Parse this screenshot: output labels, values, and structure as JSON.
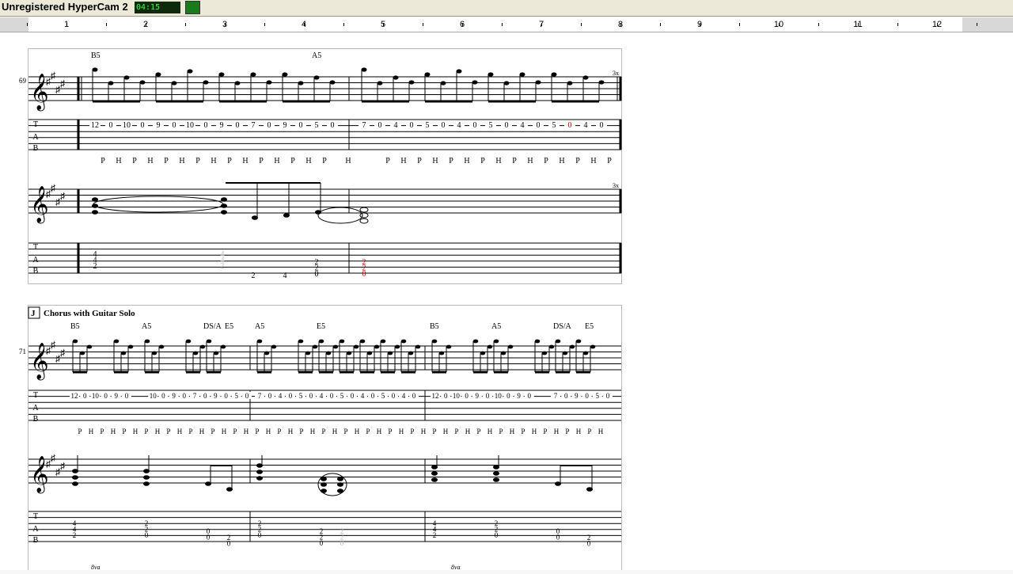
{
  "window": {
    "watermark": "Unregistered HyperCam 2",
    "timer": "04:15"
  },
  "ruler": {
    "numbers": [
      "1",
      "2",
      "3",
      "4",
      "5",
      "6",
      "7",
      "8",
      "9",
      "10",
      "11",
      "12"
    ]
  },
  "score": {
    "system1": {
      "measure_number": "69",
      "chords": [
        "B5",
        "A5"
      ],
      "repeat_label": "3x",
      "tab_row1": [
        "12",
        "0",
        "10",
        "0",
        "9",
        "0",
        "10",
        "0",
        "9",
        "0",
        "7",
        "0",
        "9",
        "0",
        "5",
        "0",
        "7",
        "0",
        "4",
        "0",
        "5",
        "0",
        "4",
        "0",
        "5",
        "0",
        "4",
        "0",
        "5",
        "0",
        "4",
        "0"
      ],
      "highlighted_fret": "0",
      "techniques": [
        "P",
        "H",
        "P",
        "H",
        "P",
        "H",
        "P",
        "H",
        "P",
        "H",
        "P",
        "H",
        "P",
        "H",
        "P",
        "H",
        "P",
        "H",
        "P",
        "H",
        "P",
        "H",
        "P",
        "H",
        "P",
        "H",
        "P",
        "H",
        "P",
        "H",
        "P",
        "H"
      ],
      "rhythm_tab": {
        "m1_chord": [
          "4",
          "4",
          "2"
        ],
        "m1_run": [
          "2",
          "4"
        ],
        "m1_end": [
          "2",
          "2",
          "0"
        ],
        "m2_chord": [
          "2",
          "2",
          "0"
        ]
      }
    },
    "system2": {
      "section_letter": "J",
      "section_title": "Chorus with Guitar Solo",
      "measure_number": "71",
      "chords": [
        "B5",
        "A5",
        "DS/A",
        "E5",
        "A5",
        "E5",
        "B5",
        "A5",
        "DS/A",
        "E5"
      ],
      "tab_row1": [
        "12",
        "0",
        "10",
        "0",
        "9",
        "0",
        "10",
        "0",
        "9",
        "0",
        "7",
        "0",
        "9",
        "0",
        "5",
        "0",
        "7",
        "0",
        "4",
        "0",
        "5",
        "0",
        "4",
        "0",
        "5",
        "0",
        "4",
        "0",
        "5",
        "0",
        "4",
        "0",
        "12",
        "0",
        "10",
        "0",
        "9",
        "0",
        "10",
        "0",
        "9",
        "0",
        "7",
        "0",
        "9",
        "0",
        "5",
        "0"
      ],
      "techniques": [
        "P",
        "H",
        "P",
        "H",
        "P",
        "H",
        "P",
        "H",
        "P",
        "H",
        "P",
        "H",
        "P",
        "H",
        "P",
        "H",
        "P",
        "H",
        "P",
        "H",
        "P",
        "H",
        "P",
        "H",
        "P",
        "H",
        "P",
        "H",
        "P",
        "H",
        "P",
        "H",
        "P",
        "H",
        "P",
        "H",
        "P",
        "H",
        "P",
        "H",
        "P",
        "H",
        "P",
        "H",
        "P",
        "H",
        "P",
        "H"
      ],
      "rhythm_tab": [
        [
          "4",
          "4",
          "2"
        ],
        [
          "2",
          "2",
          "0"
        ],
        [
          "0",
          "0"
        ],
        [
          "2",
          "0"
        ],
        [
          "2",
          "2",
          "0"
        ],
        [
          "2",
          "2",
          "0"
        ],
        [
          "2",
          "2",
          "0"
        ],
        [
          "4",
          "4",
          "2"
        ],
        [
          "2",
          "2",
          "0"
        ],
        [
          "0",
          "0"
        ],
        [
          "2",
          "0"
        ]
      ],
      "ottava": "8va"
    },
    "tab_letters": [
      "T",
      "A",
      "B"
    ]
  },
  "colors": {
    "highlight": "#cc0000",
    "timer_bg": "#0d2a0d",
    "timer_fg": "#3cff3c"
  }
}
